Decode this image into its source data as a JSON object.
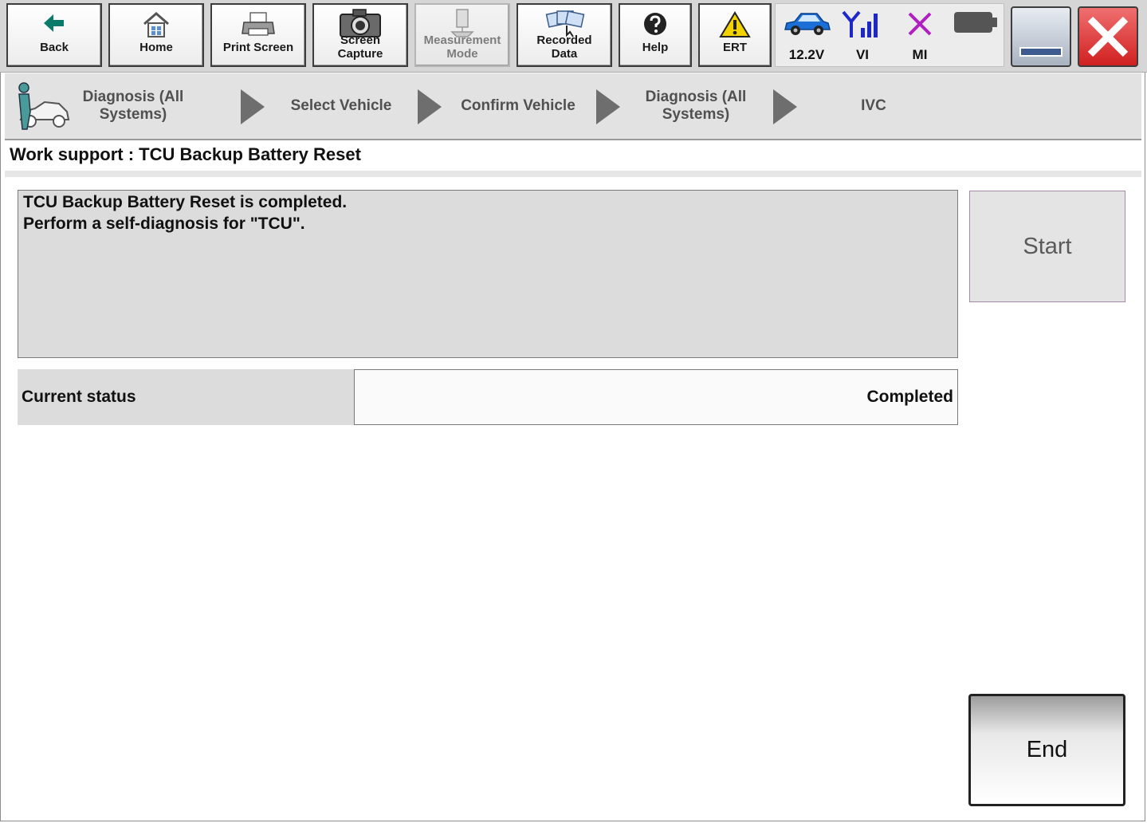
{
  "toolbar": {
    "back": "Back",
    "home": "Home",
    "print_screen": "Print Screen",
    "screen_capture_1": "Screen",
    "screen_capture_2": "Capture",
    "measurement_1": "Measurement",
    "measurement_2": "Mode",
    "recorded_1": "Recorded",
    "recorded_2": "Data",
    "help": "Help",
    "ert": "ERT"
  },
  "status": {
    "voltage": "12.2V",
    "vi": "VI",
    "mi": "MI"
  },
  "breadcrumb": {
    "step1_line1": "Diagnosis (All",
    "step1_line2": "Systems)",
    "step2": "Select Vehicle",
    "step3": "Confirm Vehicle",
    "step4_line1": "Diagnosis (All",
    "step4_line2": "Systems)",
    "step5": "IVC"
  },
  "page": {
    "title": "Work support : TCU Backup Battery Reset"
  },
  "message": {
    "line1": "TCU Backup Battery Reset is completed.",
    "line2": "Perform a self-diagnosis for \"TCU\"."
  },
  "current_status": {
    "label": "Current status",
    "value": "Completed"
  },
  "buttons": {
    "start": "Start",
    "end": "End"
  },
  "colors": {
    "back_arrow": "#0a7a6a",
    "vi_signal": "#1e28c8",
    "mi_cross": "#b020c0",
    "car": "#1c6fd6",
    "close": "#d02020"
  }
}
